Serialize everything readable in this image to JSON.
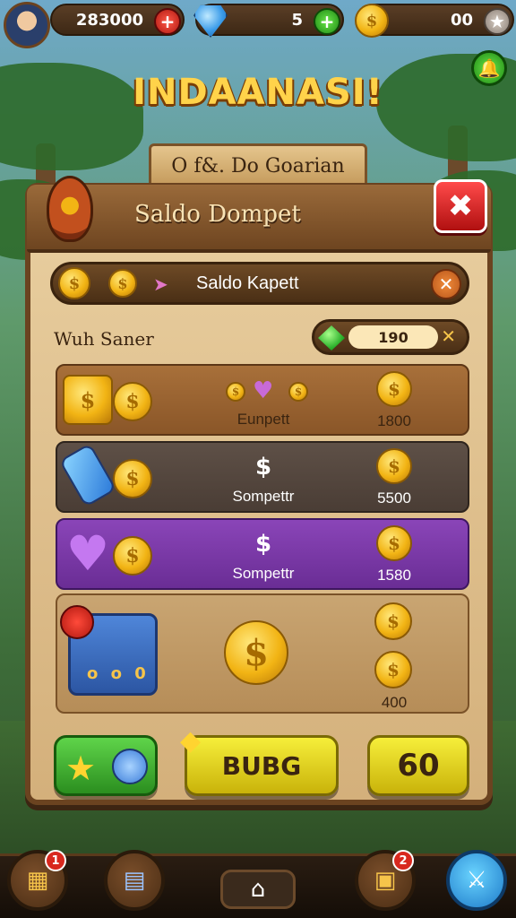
{
  "hud": {
    "coins_value": "283000",
    "gems_value": "5",
    "gold_value": "00"
  },
  "game_title": "INDAANASI!",
  "plaque_text": "O f&. Do Goarian",
  "panel": {
    "title": "Saldo Dompet",
    "balance_label": "Saldo Kapett",
    "section_label": "Wuh Saner",
    "section_value": "190"
  },
  "rows": [
    {
      "name": "Eunpett",
      "price": "1800",
      "symbol": ""
    },
    {
      "name": "Sompettr",
      "price": "5500",
      "symbol": "$"
    },
    {
      "name": "Sompettr",
      "price": "1580",
      "symbol": "$"
    }
  ],
  "big_row": {
    "price": "400",
    "card_value": "0"
  },
  "buttons": {
    "buy_label": "BUBG",
    "count_label": "60"
  },
  "nav": {
    "badge_left": "1",
    "badge_right": "2"
  },
  "colors": {
    "accent_gold": "#f2b414",
    "close_red": "#d8281e",
    "button_yellow": "#f6ee3a",
    "button_green": "#2b8e1f",
    "row_purple": "#8a45b8"
  }
}
